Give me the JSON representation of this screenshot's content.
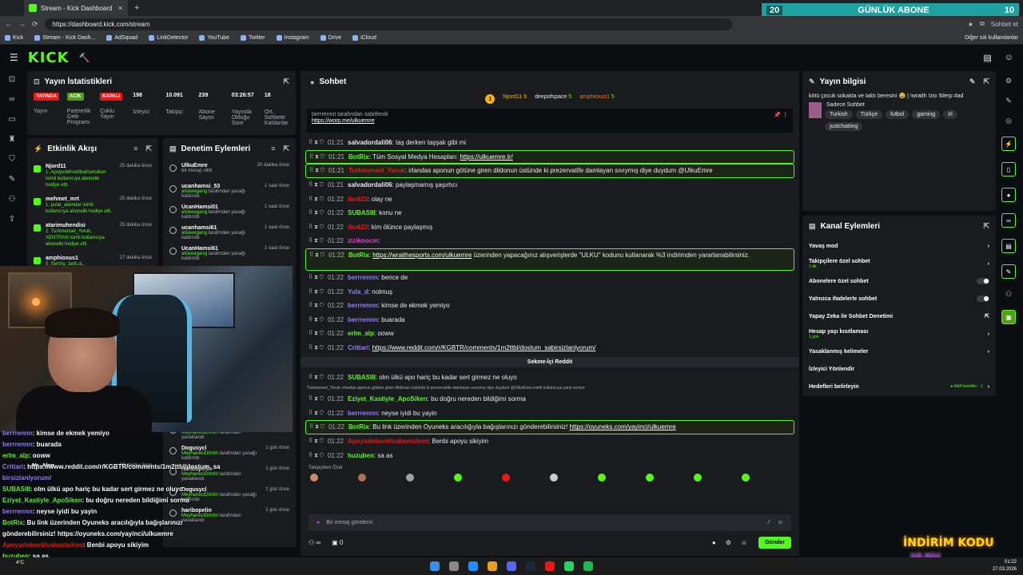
{
  "browser": {
    "tab_title": "Stream - Kick Dashboard",
    "url": "https://dashboard.kick.com/stream",
    "profile_label": "Sohbet et",
    "bookmarks": [
      "Kick",
      "Stream - Kick Dash...",
      "AdSquad",
      "LinkDetector",
      "YouTube",
      "Twitter",
      "Instagram",
      "Drive",
      "iCloud"
    ],
    "bookmarks_other": "Diğer sık kullanılanlar"
  },
  "overlay_banner": {
    "left": "20",
    "title": "GÜNLÜK ABONE",
    "right": "10"
  },
  "kick": {
    "logo": "KICK"
  },
  "stats": {
    "title": "Yayın İstatistikleri",
    "items": [
      {
        "badge": "YAYINDA",
        "label": "Yayın",
        "color": "#e91916"
      },
      {
        "badge": "ACIK",
        "label": "Partnerlik Gelir Programı",
        "color": "#53a016"
      },
      {
        "badge": "KAPALI",
        "label": "Çoklu Yayın",
        "color": "#e91916"
      },
      {
        "value": "198",
        "label": "İzleyici"
      },
      {
        "value": "10.091",
        "label": "Takipçi"
      },
      {
        "value": "239",
        "label": "Abone Sayısı"
      },
      {
        "value": "03:26:57",
        "label": "Yayında Olduğu Süre"
      },
      {
        "value": "18",
        "label": "Ort. Sohbete Katılanlar"
      }
    ]
  },
  "activity": {
    "title": "Etkinlik Akışı",
    "items": [
      {
        "name": "Njord11",
        "desc": "1, Apoyudehsetilvahsetsiken isimli kullanıcıya abonelik hediye etti.",
        "time": "25 dakika önce"
      },
      {
        "name": "mehmet_mrt",
        "desc": "1, pulat_alemdar isimli kullanıcıya abonelik hediye etti.",
        "time": "25 dakika önce"
      },
      {
        "name": "atarimuhendisi",
        "desc": "2, Turkmensel_Yoruk, XENTRAH isimli kullanıcıya abonelik hediye etti.",
        "time": "25 dakika önce"
      },
      {
        "name": "amphioxus1",
        "desc": "5, SertAy, JarlLuL, atarimuhendisi, mehmet_mrt,",
        "time": "27 dakika önce"
      }
    ]
  },
  "moderation": {
    "title": "Denetim Eylemleri",
    "items": [
      {
        "name": "UlkuEmre",
        "desc": "bir mesajı sildi",
        "by": "",
        "time": "20 dakika önce"
      },
      {
        "name": "ucanhamsi_53",
        "desc": "tarafından yasağı kaldırıldı",
        "by": "aliskeegang",
        "time": "1 saat önce"
      },
      {
        "name": "UcanHamsi01",
        "desc": "tarafından yasağı kaldırıldı",
        "by": "aliskeegang",
        "time": "1 saat önce"
      },
      {
        "name": "ucanhamsi61",
        "desc": "tarafından yasağı kaldırıldı",
        "by": "aliskeegang",
        "time": "1 saat önce"
      },
      {
        "name": "UcanHamsi61",
        "desc": "tarafından yasağı kaldırıldı",
        "by": "aliskeegang",
        "time": "1 saat önce"
      }
    ],
    "bottom_items": [
      {
        "name": "Psihalive",
        "desc": "tarafından yasaklandı",
        "by": "MeyhaneciDimitri",
        "time": "1 gün önce"
      },
      {
        "name": "Dogusycl",
        "desc": "tarafından yasağı kaldırıldı",
        "by": "MeyhaneciDimitri",
        "time": "1 gün önce"
      },
      {
        "name": "haribopelin",
        "desc": "tarafından yasaklandı",
        "by": "MeyhaneciDimitri",
        "time": "1 gün önce"
      },
      {
        "name": "Dogusycl",
        "desc": "tarafından yasağı kaldırıldı",
        "by": "MeyhaneciDimitri",
        "time": "1 gün önce"
      },
      {
        "name": "haribopelin",
        "desc": "tarafından yasaklandı",
        "by": "MeyhaneciDimitri",
        "time": "1 gün önce"
      }
    ],
    "footer_left": "Mr_Alpp",
    "footer_time": "34 dakika önce"
  },
  "overlay_chat": [
    {
      "user": "berrrennn",
      "text": ": kimse de ekmek yemiyo",
      "color": "#9b7bff"
    },
    {
      "user": "berrrennn",
      "text": ": buarada",
      "color": "#9b7bff"
    },
    {
      "user": "erlm_alp",
      "text": ": ooww",
      "color": "#53fc18"
    },
    {
      "user": "Crittari",
      "text": ": https://www.reddit.com/r/KGBTR/comments/1m2ttbl/dostum_sa",
      "color": "#9b7bff"
    },
    {
      "user": "",
      "text": "birsizlanlyorum/",
      "color": "#9b7bff"
    },
    {
      "user": "SUBASIII",
      "text": ": olm ülkü apo hariç bu kadar sert girmez ne oluyo",
      "color": "#53fc18"
    },
    {
      "user": "Eziyet_Kastiyle_ApoSiken",
      "text": ": bu doğru nereden bildiğimi sorma",
      "color": "#53fc18"
    },
    {
      "user": "berrrennn",
      "text": ": neyse iyidi bu yayin",
      "color": "#9b7bff"
    },
    {
      "user": "BotRix",
      "text": ": Bu link üzerinden Oyuneks aracılığıyla bağışlarınızı",
      "color": "#53fc18"
    },
    {
      "user": "",
      "text": "gönderebilirsiniz! https://oyuneks.com/yayinci/ulkuemre",
      "color": "#fff"
    },
    {
      "user": "Apoyudehsetilvahsetsiken",
      "text": ": Benbi apoyu sikiyim",
      "color": "#e91916"
    },
    {
      "user": "huzuben",
      "text": ": sa as",
      "color": "#53fc18"
    }
  ],
  "chat": {
    "title": "Sohbet",
    "top_user1": "Njord11",
    "top_user1_count": "6",
    "top_user2": "deepofspace",
    "top_user2_count": "5",
    "top_user3": "amphioxus1",
    "top_user3_count": "5",
    "pinned_by": "berrrennn tarafından sabitlendi",
    "pinned_link": "https://worp.me/ulkuemre",
    "messages": [
      {
        "time": "01:21",
        "user": "salvadordali06",
        "color": "#e8eaed",
        "text": "taş derken taşşak gibi mi",
        "hl": false
      },
      {
        "time": "01:21",
        "user": "BotRix",
        "color": "#53fc18",
        "text": "Tüm Sosyal Medya Hesapları:",
        "link": "https://ulkuemre.tr/",
        "hl": true
      },
      {
        "time": "01:21",
        "user": "Turkmensel_Yoruk",
        "color": "#e91916",
        "text": "irlandas aponun götüne giren dildonun üstünde ki prezervatife damlayan sıvıymış diye duydum @UlkuEmre",
        "hl": true
      },
      {
        "time": "01:21",
        "user": "salvadordali06",
        "color": "#e8eaed",
        "text": "paylaşmamış şaşırtıcı",
        "hl": false
      },
      {
        "time": "01:22",
        "user": "ibo623",
        "color": "#e91916",
        "text": "olay ne",
        "hl": false
      },
      {
        "time": "01:22",
        "user": "SUBASIII",
        "color": "#53fc18",
        "text": "konu ne",
        "hl": false
      },
      {
        "time": "01:22",
        "user": "ibo623",
        "color": "#e91916",
        "text": "kim ölünce paylaşmış",
        "hl": false
      },
      {
        "time": "01:22",
        "user": "zizikoocm",
        "color": "#e040c0",
        "text": "",
        "hl": false
      },
      {
        "time": "01:22",
        "user": "BotRix",
        "color": "#53fc18",
        "text": "üzerinden yapacağınız alışverişlerde \"ULKU\" kodunu kullanarak %3 indirimden yararlanabilirsiniz.",
        "link": "https://wraithesports.com/ulkuemre",
        "hl": true,
        "tall": true
      },
      {
        "time": "01:22",
        "user": "berrrennn",
        "color": "#9b7bff",
        "text": "bence de",
        "hl": false
      },
      {
        "time": "01:22",
        "user": "Yula_d",
        "color": "#9b7bff",
        "text": "nolmuş",
        "hl": false
      },
      {
        "time": "01:22",
        "user": "berrrennn",
        "color": "#9b7bff",
        "text": "kimse de ekmek yemiyo",
        "hl": false
      },
      {
        "time": "01:22",
        "user": "berrrennn",
        "color": "#9b7bff",
        "text": "buarada",
        "hl": false
      },
      {
        "time": "01:22",
        "user": "erlm_alp",
        "color": "#53fc18",
        "text": "ooww",
        "hl": false
      },
      {
        "time": "01:22",
        "user": "Crittari",
        "color": "#9b7bff",
        "text": "",
        "link": "https://www.reddit.com/r/KGBTR/comments/1m2ttbl/dostum_sabirsizlanlyorum/",
        "hl": false
      }
    ],
    "separator": "Sekme-İçi Reddit",
    "messages2": [
      {
        "time": "01:22",
        "user": "SUBASIII",
        "color": "#53fc18",
        "text": "olm ülkü apo hariç bu kadar sert girmez ne oluyo",
        "hl": false
      }
    ],
    "reply_line": "Turkmensel_Yoruk: irlandas aponun götüne giren dildonun üstünde ki prezervatife damlayan sıvıymış diye duydum @UlkuEmre isimli kullanıcıya yanıt veriyor",
    "messages3": [
      {
        "time": "01:22",
        "user": "Eziyet_Kastiyle_ApoSiken",
        "color": "#53fc18",
        "text": "bu doğru nereden bildiğimi sorma",
        "hl": false
      },
      {
        "time": "01:22",
        "user": "berrrennn",
        "color": "#9b7bff",
        "text": "neyse iyidi bu yayin",
        "hl": false
      },
      {
        "time": "01:22",
        "user": "BotRix",
        "color": "#53fc18",
        "text": "Bu link üzerinden Oyuneks aracılığıyla bağışlarınızı gönderebilirsiniz!",
        "link": "https://oyuneks.com/yayinci/ulkuemre",
        "hl": true
      },
      {
        "time": "01:22",
        "user": "Apoyudehsetilvahsetsiken",
        "color": "#e91916",
        "text": "Benbi apoyu sikiyim",
        "hl": false
      },
      {
        "time": "01:22",
        "user": "huzuben",
        "color": "#53fc18",
        "text": "sa as",
        "hl": false
      }
    ],
    "emote_label": "Takipçilere Özel",
    "input_placeholder": "Bir mesaj gönderin",
    "footer_count": "0",
    "send_label": "Gönder"
  },
  "stream_info": {
    "title": "Yayın bilgisi",
    "stream_title": "kötü çocuk sokakta ve taktı beresini 😂 | !wraith !zio !blerp #ad",
    "category": "Sadece Sohbet",
    "tags": [
      "Turkish",
      "Türkçe",
      "futbol",
      "gaming",
      "irl",
      "justchatting"
    ]
  },
  "channel_actions": {
    "title": "Kanal Eylemleri",
    "items": [
      {
        "label": "Yavaş mod",
        "sub": "",
        "kind": "arrow"
      },
      {
        "label": "Takipçilere özel sohbet",
        "sub": "1 dk.",
        "kind": "arrow"
      },
      {
        "label": "Abonelere özel sohbet",
        "sub": "",
        "kind": "toggle"
      },
      {
        "label": "Yalnızca ifadelerle sohbet",
        "sub": "",
        "kind": "toggle"
      },
      {
        "label": "Yapay Zeka ile Sohbet Denetimi",
        "sub": "",
        "kind": "ext"
      },
      {
        "label": "Hesap yaşı kısıtlaması",
        "sub": "1 gün",
        "kind": "arrow"
      },
      {
        "label": "Yasaklanmış kelimeler",
        "sub": "",
        "kind": "arrow"
      },
      {
        "label": "İzleyici Yönlendir",
        "sub": "",
        "kind": "none"
      },
      {
        "label": "Hedefleri belirleyin",
        "sub": "",
        "kind": "arrow",
        "right": "Aktif hedefler - 1"
      }
    ]
  },
  "overlay_promo": {
    "line1": "İNDİRİM KODU",
    "line2": "ULKU"
  },
  "taskbar": {
    "time": "01:22",
    "date": "27.03.2026",
    "weather": "4°C"
  },
  "colors": {
    "accent": "#53fc18",
    "panel": "#191b1f",
    "bg": "#0b0e11"
  }
}
